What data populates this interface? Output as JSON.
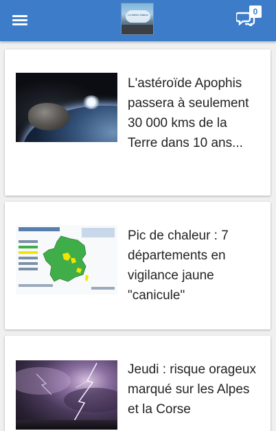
{
  "header": {
    "menu_icon": "hamburger-menu-icon",
    "logo_text": "La Météo Nature",
    "chat_icon": "chat-bubbles-icon",
    "notification_count": "0"
  },
  "colors": {
    "header_bg": "#3d7cc9",
    "page_bg": "#f0f0f0",
    "card_bg": "#ffffff",
    "title_text": "#222222"
  },
  "articles": [
    {
      "title": "L'astéroïde Apophis passera à seulement 30 000 kms de la Terre dans 10 ans...",
      "image": "asteroid-near-earth"
    },
    {
      "title": "Pic de chaleur : 7 départements en vigilance jaune \"canicule\"",
      "image": "vigilance-map-france"
    },
    {
      "title": "Jeudi : risque orageux marqué sur les Alpes et la Corse",
      "image": "thunderstorm-lightning"
    }
  ],
  "map_thumbnail": {
    "header_text": "Vigilance météorologique",
    "legend_colors": {
      "green": "#3fae49",
      "yellow": "#f2e500"
    },
    "yellow_departements": 7
  }
}
